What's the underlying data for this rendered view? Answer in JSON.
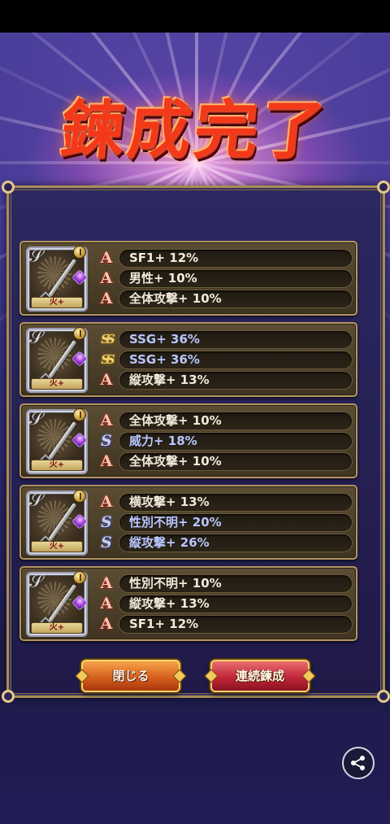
{
  "title": "鍊成完了",
  "weapons": [
    {
      "element": "火+",
      "stats": [
        {
          "rank": "A",
          "text": "SF1+ 12%"
        },
        {
          "rank": "A",
          "text": "男性+ 10%"
        },
        {
          "rank": "A",
          "text": "全体攻撃+ 10%"
        }
      ]
    },
    {
      "element": "火+",
      "stats": [
        {
          "rank": "SS",
          "text": "SSG+ 36%"
        },
        {
          "rank": "SS",
          "text": "SSG+ 36%"
        },
        {
          "rank": "A",
          "text": "縦攻撃+ 13%"
        }
      ]
    },
    {
      "element": "火+",
      "stats": [
        {
          "rank": "A",
          "text": "全体攻撃+ 10%"
        },
        {
          "rank": "S",
          "text": "威力+ 18%"
        },
        {
          "rank": "A",
          "text": "全体攻撃+ 10%"
        }
      ]
    },
    {
      "element": "火+",
      "stats": [
        {
          "rank": "A",
          "text": "横攻撃+ 13%"
        },
        {
          "rank": "S",
          "text": "性別不明+ 20%"
        },
        {
          "rank": "S",
          "text": "縦攻撃+ 26%"
        }
      ]
    },
    {
      "element": "火+",
      "stats": [
        {
          "rank": "A",
          "text": "性別不明+ 10%"
        },
        {
          "rank": "A",
          "text": "縦攻撃+ 13%"
        },
        {
          "rank": "A",
          "text": "SF1+ 12%"
        }
      ]
    }
  ],
  "buttons": {
    "close": "閉じる",
    "continue": "連続鍊成"
  },
  "icons": {
    "share": "share-icon",
    "rank_a": "rank-a-icon",
    "rank_s": "rank-s-icon",
    "rank_ss": "rank-ss-icon"
  }
}
